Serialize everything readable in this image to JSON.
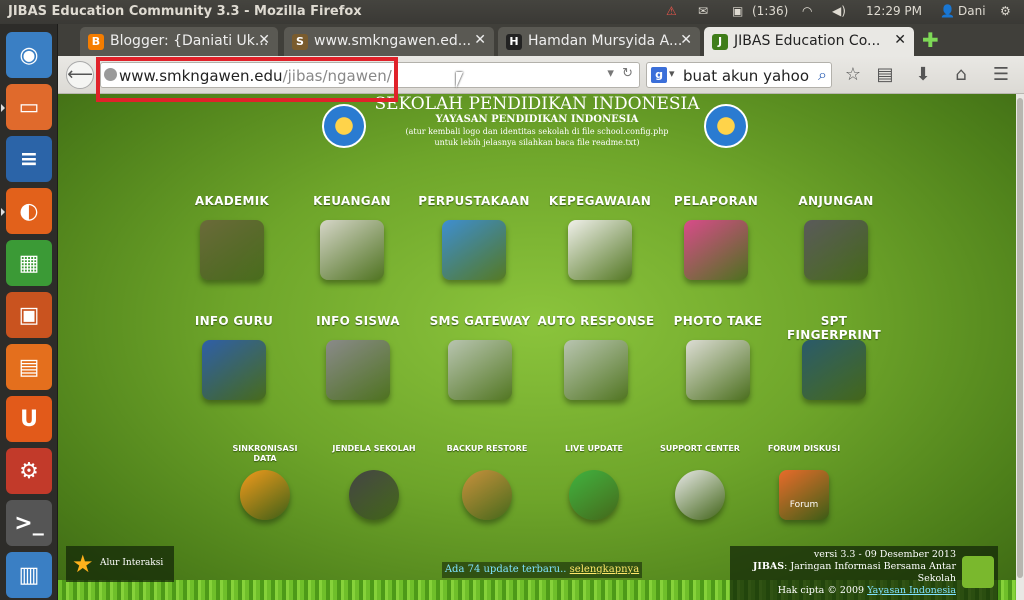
{
  "topbar": {
    "window_title": "JIBAS Education Community 3.3 - Mozilla Firefox",
    "battery": "(1:36)",
    "clock": "12:29 PM",
    "user": "Dani"
  },
  "tabs": [
    {
      "label": "Blogger: {Daniati Uk...",
      "icon": "B",
      "color": "#f57d00"
    },
    {
      "label": "www.smkngawen.ed...",
      "icon": "S",
      "color": "#7a5c2e"
    },
    {
      "label": "Hamdan Mursyida A...",
      "icon": "H",
      "color": "#222222"
    },
    {
      "label": "JIBAS Education Co...",
      "icon": "J",
      "color": "#3f7d19"
    }
  ],
  "navbar": {
    "url_host": "www.smkngawen.edu",
    "url_path": "/jibas/ngawen/",
    "search_value": "buat akun yahoo",
    "search_engine": "g"
  },
  "page": {
    "school_name": "SEKOLAH PENDIDIKAN INDONESIA",
    "foundation": "YAYASAN PENDIDIKAN INDONESIA",
    "note_line1": "(atur kembali logo dan identitas sekolah di file school.config.php",
    "note_line2": "untuk lebih jelasnya silahkan baca file readme.txt)",
    "modules_row1": [
      {
        "label": "AKADEMIK",
        "color": "#6b6b3a"
      },
      {
        "label": "KEUANGAN",
        "color": "#d6d6c8"
      },
      {
        "label": "PERPUSTAKAAN",
        "color": "#3f8fd1"
      },
      {
        "label": "KEPEGAWAIAN",
        "color": "#f0f0ea"
      },
      {
        "label": "PELAPORAN",
        "color": "#d94b8a"
      },
      {
        "label": "ANJUNGAN",
        "color": "#5a5a5a"
      }
    ],
    "modules_row2": [
      {
        "label": "INFO GURU",
        "color": "#2f5fa8"
      },
      {
        "label": "INFO SISWA",
        "color": "#8a8a8a"
      },
      {
        "label": "SMS GATEWAY",
        "color": "#b8c4b0"
      },
      {
        "label": "AUTO RESPONSE",
        "color": "#b8c4b0"
      },
      {
        "label": "PHOTO TAKE",
        "color": "#dcdcd4"
      },
      {
        "label": "SPT FINGERPRINT",
        "color": "#2a5a6a"
      }
    ],
    "modules_row3": [
      {
        "label": "SINKRONISASI DATA",
        "color": "#f29a1c"
      },
      {
        "label": "JENDELA SEKOLAH",
        "color": "#444444"
      },
      {
        "label": "BACKUP RESTORE",
        "color": "#c8903c"
      },
      {
        "label": "LIVE UPDATE",
        "color": "#3fb23f"
      },
      {
        "label": "SUPPORT CENTER",
        "color": "#e8e8e8"
      },
      {
        "label": "FORUM DISKUSI",
        "color": "#e86a2a"
      }
    ],
    "forum_icon_text": "Forum",
    "alur_label": "Alur Interaksi",
    "update_text": "Ada 74 update terbaru..",
    "update_link": "selengkapnya",
    "version_line": "versi 3.3 - 09 Desember 2013",
    "jibas_bold": "JIBAS",
    "jibas_desc": ": Jaringan Informasi Bersama Antar Sekolah",
    "copyright": "Hak cipta © 2009",
    "copyright_link": "Yayasan Indonesia"
  },
  "launcher": [
    {
      "name": "ubuntu-dash-icon",
      "color": "#3a7fc4",
      "glyph": "◉"
    },
    {
      "name": "files-folder-icon",
      "color": "#e06a2c",
      "glyph": "▭"
    },
    {
      "name": "libreoffice-writer-icon",
      "color": "#2b64a8",
      "glyph": "≡"
    },
    {
      "name": "firefox-icon",
      "color": "#e2611b",
      "glyph": "◐"
    },
    {
      "name": "libreoffice-calc-icon",
      "color": "#3b9a36",
      "glyph": "▦"
    },
    {
      "name": "libreoffice-impress-icon",
      "color": "#c9531f",
      "glyph": "▣"
    },
    {
      "name": "software-center-icon",
      "color": "#e46f1d",
      "glyph": "▤"
    },
    {
      "name": "ubuntu-one-icon",
      "color": "#e25a1a",
      "glyph": "U"
    },
    {
      "name": "system-settings-icon",
      "color": "#c23a2a",
      "glyph": "⚙"
    },
    {
      "name": "terminal-icon",
      "color": "#555555",
      "glyph": ">_"
    },
    {
      "name": "workspace-switcher-icon",
      "color": "#3a7fc4",
      "glyph": "▥"
    }
  ]
}
